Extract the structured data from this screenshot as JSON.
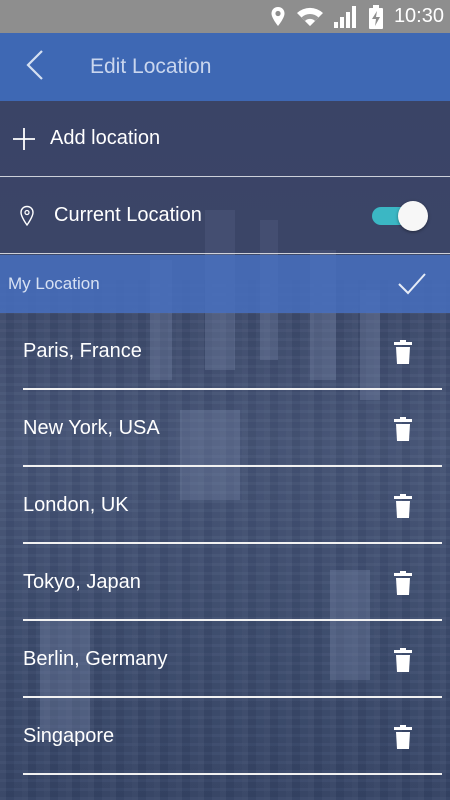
{
  "status_bar": {
    "time": "10:30",
    "icons": [
      "location-icon",
      "wifi-icon",
      "signal-icon",
      "battery-charging-icon"
    ]
  },
  "app_bar": {
    "title": "Edit Location",
    "back_icon": "chevron-left-icon"
  },
  "add_location": {
    "label": "Add location",
    "icon": "plus-icon"
  },
  "current_location": {
    "label": "Current Location",
    "icon": "map-pin-icon",
    "enabled": true,
    "toggle_color": "#3bb7c4"
  },
  "my_location": {
    "label": "My Location",
    "icon": "checkmark-icon"
  },
  "locations": [
    {
      "name": "Paris, France"
    },
    {
      "name": "New York, USA"
    },
    {
      "name": "London, UK"
    },
    {
      "name": "Tokyo, Japan"
    },
    {
      "name": "Berlin, Germany"
    },
    {
      "name": "Singapore"
    }
  ],
  "colors": {
    "app_bar": "#3e68b4",
    "my_location_bar": "#466ebe",
    "status_bar": "#8e8e8e"
  }
}
